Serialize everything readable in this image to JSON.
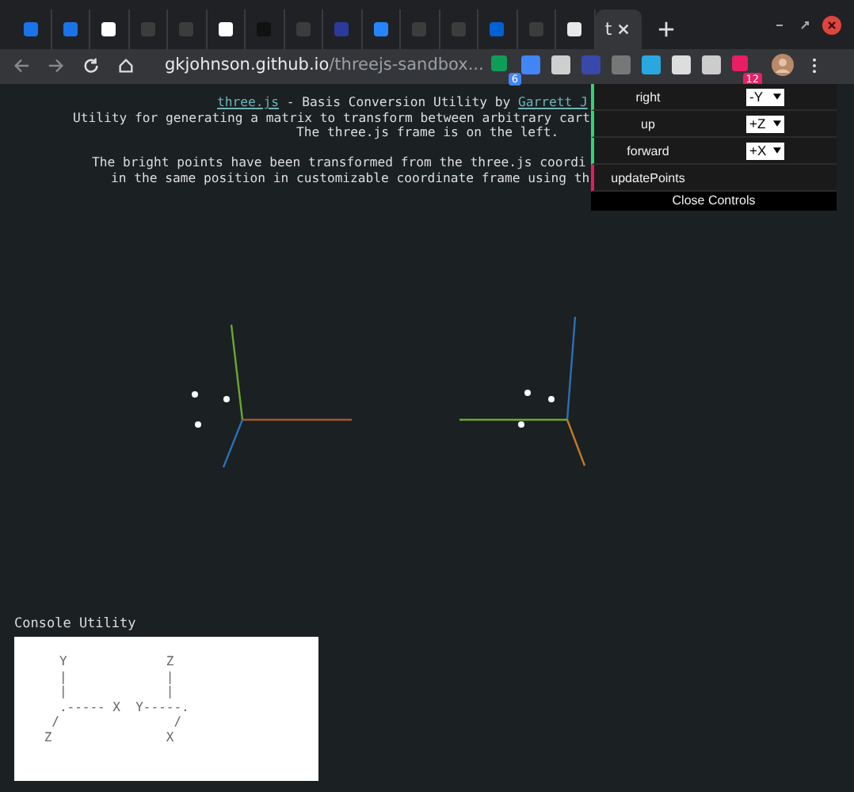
{
  "tabs": [
    {
      "selected": false,
      "color": "#1a73e8"
    },
    {
      "selected": false,
      "color": "#1a73e8"
    },
    {
      "selected": false,
      "color": "#ffffff"
    },
    {
      "selected": false,
      "color": "#3c3c3c"
    },
    {
      "selected": false,
      "color": "#3c3c3c"
    },
    {
      "selected": false,
      "color": "#ffffff"
    },
    {
      "selected": false,
      "color": "#111111"
    },
    {
      "selected": false,
      "color": "#3c3c3c"
    },
    {
      "selected": false,
      "color": "#2b3a9c"
    },
    {
      "selected": false,
      "color": "#2684ff"
    },
    {
      "selected": false,
      "color": "#3c3c3c"
    },
    {
      "selected": false,
      "color": "#3c3c3c"
    },
    {
      "selected": false,
      "color": "#0061d5"
    },
    {
      "selected": false,
      "color": "#3c3c3c"
    },
    {
      "selected": false,
      "color": "#e8e8e8"
    },
    {
      "selected": true,
      "title": "t"
    }
  ],
  "url": {
    "host": "gkjohnson.github.io",
    "path": "/threejs-sandbox..."
  },
  "extensions": [
    {
      "color": "#0f9d58",
      "badge": "6"
    },
    {
      "color": "#4285f4"
    },
    {
      "color": "#cfcfcf"
    },
    {
      "color": "#3949ab"
    },
    {
      "color": "#777777"
    },
    {
      "color": "#29a8e0"
    },
    {
      "color": "#dddddd"
    },
    {
      "color": "#cccccc"
    },
    {
      "color": "#e91e63",
      "badge": "12"
    }
  ],
  "header": {
    "lib_link": "three.js",
    "title_text": " - Basis Conversion Utility by ",
    "author_link": "Garrett J"
  },
  "description": [
    "Utility for generating a matrix to transform between arbitrary cart",
    "The three.js frame is on the left.",
    "The bright points have been transformed from the three.js coordi",
    "in the same position in customizable coordinate frame using th"
  ],
  "controls": [
    {
      "kind": "select",
      "label": "right",
      "value": "-Y"
    },
    {
      "kind": "select",
      "label": "up",
      "value": "+Z"
    },
    {
      "kind": "select",
      "label": "forward",
      "value": "+X"
    },
    {
      "kind": "button",
      "label": "updatePoints"
    }
  ],
  "close_controls": "Close Controls",
  "console": {
    "title": "Console Utility",
    "lines": [
      "   Y             Z",
      "   |             |",
      "   |             |",
      "   .----- X  Y-----.",
      "  /               /",
      " Z               X"
    ]
  }
}
